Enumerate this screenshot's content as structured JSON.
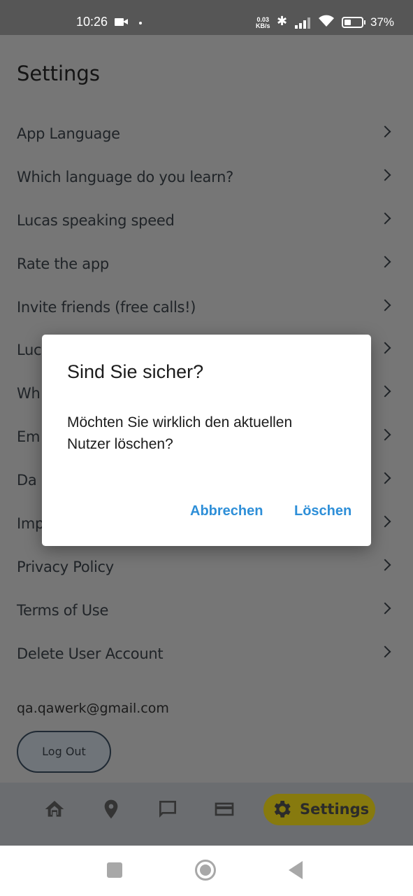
{
  "status_bar": {
    "time": "10:26",
    "net_speed_value": "0.03",
    "net_speed_unit": "KB/s",
    "battery_percent": "37%",
    "battery_level": 0.37,
    "icons": [
      "video-camera-icon",
      "dot-icon",
      "bluetooth-icon",
      "signal-icon",
      "wifi-icon",
      "battery-icon"
    ]
  },
  "page": {
    "title": "Settings"
  },
  "settings_items": [
    {
      "label": "App Language"
    },
    {
      "label": "Which language do you learn?"
    },
    {
      "label": "Lucas speaking speed"
    },
    {
      "label": "Rate the app"
    },
    {
      "label": "Invite friends (free calls!)"
    },
    {
      "label": "Luc"
    },
    {
      "label": "Wh"
    },
    {
      "label": "Em"
    },
    {
      "label": "Da"
    },
    {
      "label": "Imp"
    },
    {
      "label": "Privacy Policy"
    },
    {
      "label": "Terms of Use"
    },
    {
      "label": "Delete User Account"
    }
  ],
  "account": {
    "email": "qa.qawerk@gmail.com",
    "logout_label": "Log Out"
  },
  "bottom_nav": {
    "items": [
      {
        "icon": "home-icon"
      },
      {
        "icon": "location-pin-icon"
      },
      {
        "icon": "chat-icon"
      },
      {
        "icon": "credit-card-icon"
      },
      {
        "icon": "gear-icon",
        "label": "Settings",
        "active": true
      }
    ],
    "active_color": "#877a0e"
  },
  "dialog": {
    "title": "Sind Sie sicher?",
    "body": "Möchten Sie wirklich den aktuellen Nutzer löschen?",
    "cancel_label": "Abbrechen",
    "confirm_label": "Löschen",
    "button_color": "#2e8fd8"
  }
}
